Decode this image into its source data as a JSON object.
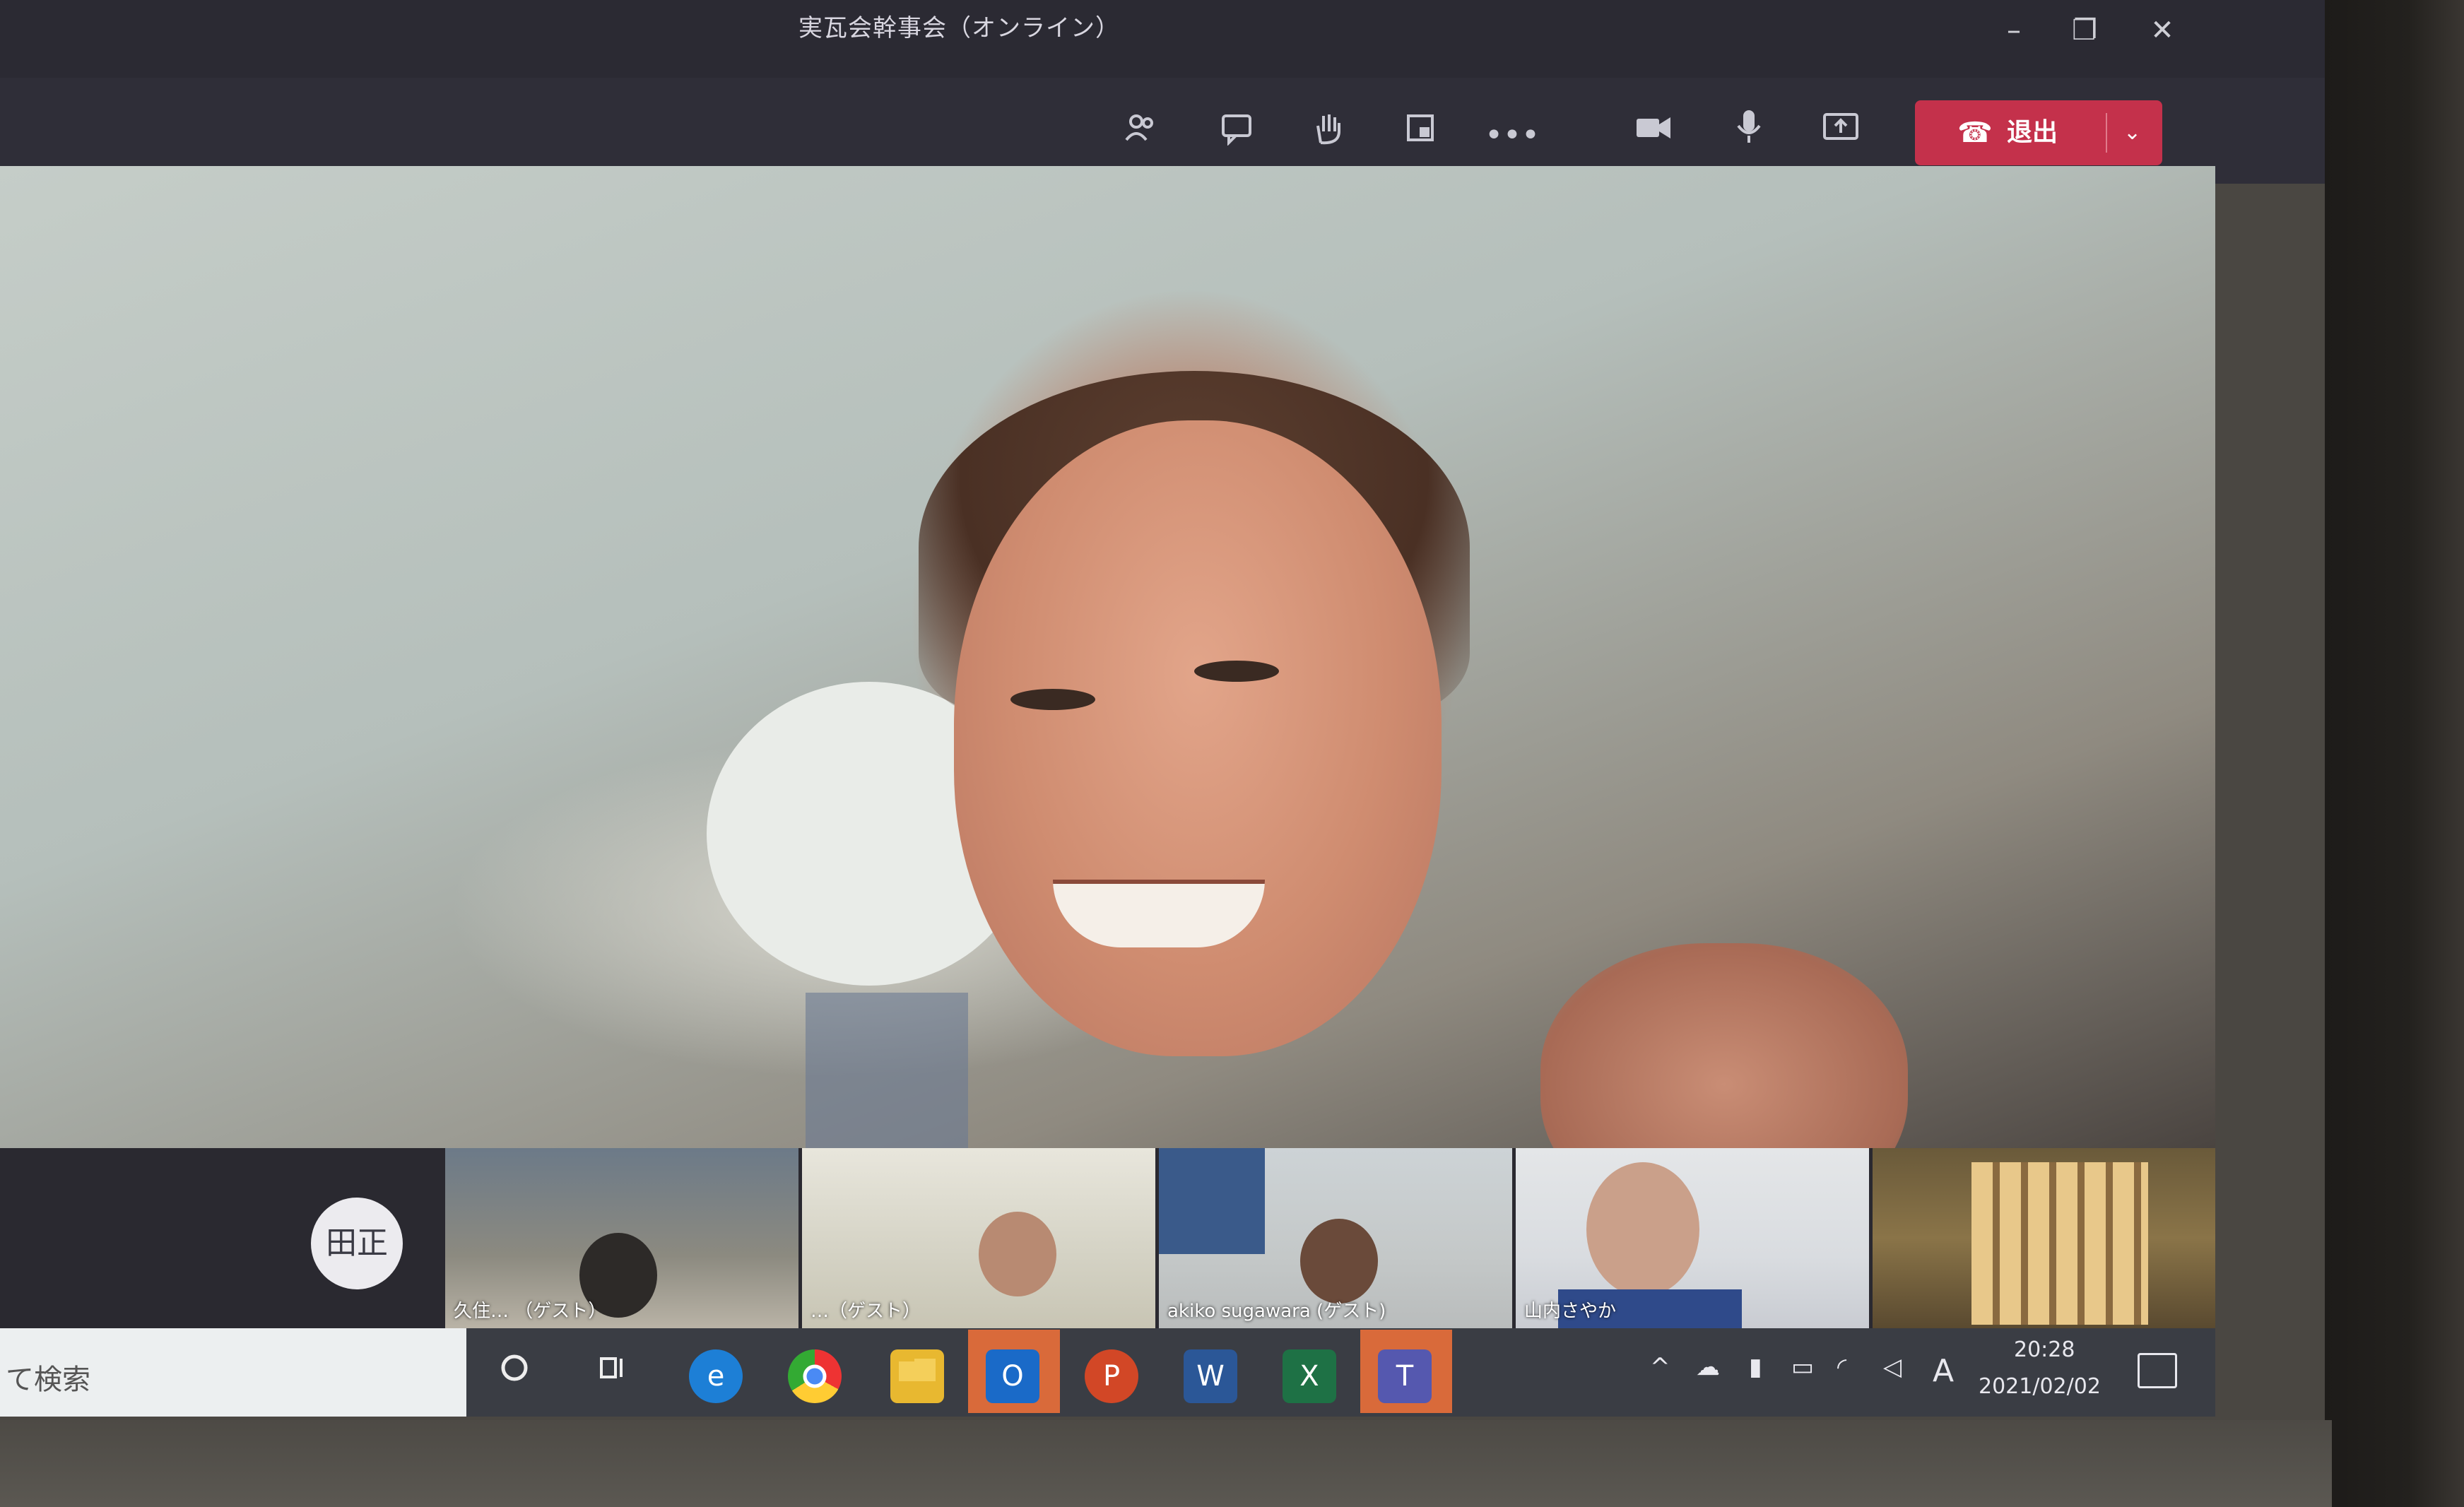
{
  "window": {
    "title": "実瓦会幹事会（オンライン）",
    "minimize": "–",
    "restore": "❐",
    "close": "✕"
  },
  "toolbar": {
    "people_icon": "people-icon",
    "chat_icon": "chat-icon",
    "raise_hand_icon": "raise-hand-icon",
    "rooms_icon": "breakout-rooms-icon",
    "more_label": "•••",
    "camera_icon": "camera-icon",
    "mic_icon": "microphone-icon",
    "share_icon": "share-screen-icon",
    "leave_label": "退出",
    "leave_color": "#c4314b"
  },
  "participants": {
    "avatar_initials": "田正",
    "tiles": [
      {
        "name": "久住… （ゲスト）"
      },
      {
        "name": "…（ゲスト）"
      },
      {
        "name": "akiko sugawara (ゲスト)"
      },
      {
        "name": "山内さやか"
      },
      {
        "name": ""
      }
    ]
  },
  "taskbar": {
    "search_placeholder": "て検索",
    "time": "20:28",
    "date": "2021/02/02",
    "ime_label": "A"
  }
}
